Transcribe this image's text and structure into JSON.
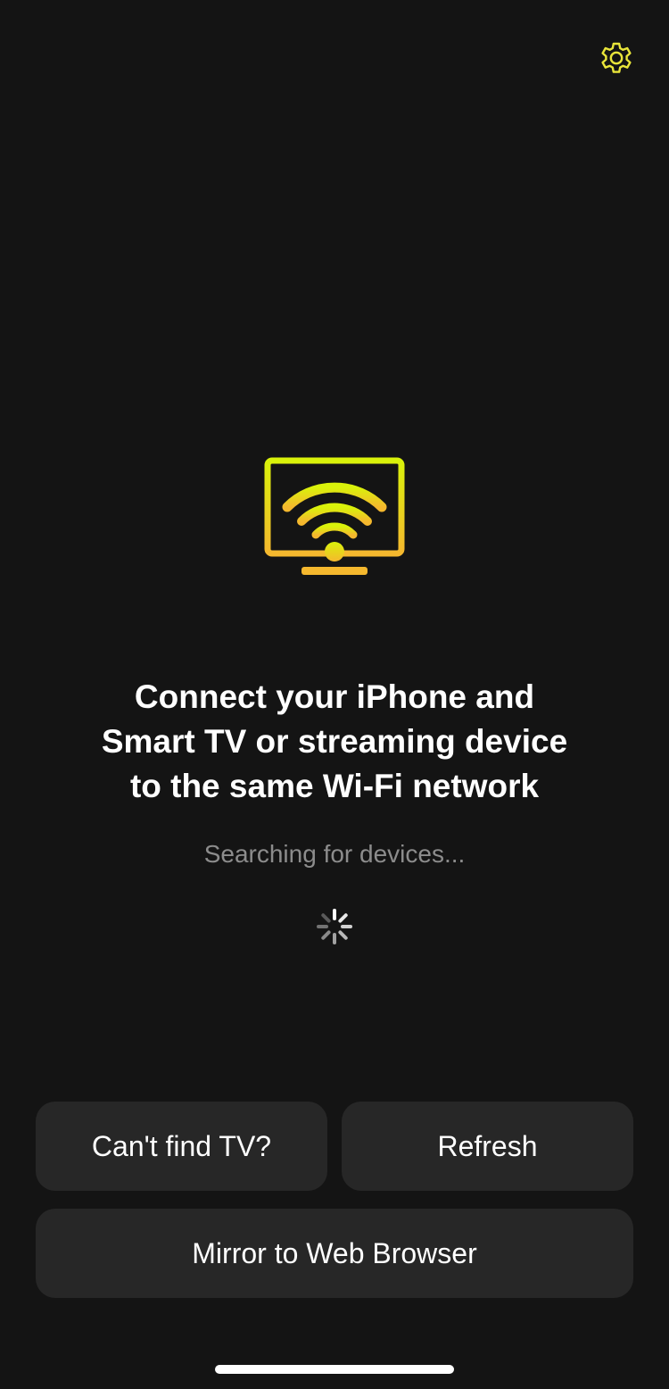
{
  "header": {
    "settings_icon": "gear-icon"
  },
  "hero": {
    "icon": "tv-wifi-icon",
    "headline_lines": [
      "Connect your iPhone and",
      "Smart TV or streaming device",
      "to the same Wi-Fi network"
    ],
    "status": "Searching for devices...",
    "loading_icon": "spinner-icon"
  },
  "actions": {
    "cant_find_label": "Can't find TV?",
    "refresh_label": "Refresh",
    "mirror_label": "Mirror to Web Browser"
  },
  "colors": {
    "background": "#141414",
    "accent_top": "#D9F20A",
    "accent_bottom": "#F5B82E",
    "button_bg": "#272727",
    "secondary_text": "#8C8C8C"
  }
}
